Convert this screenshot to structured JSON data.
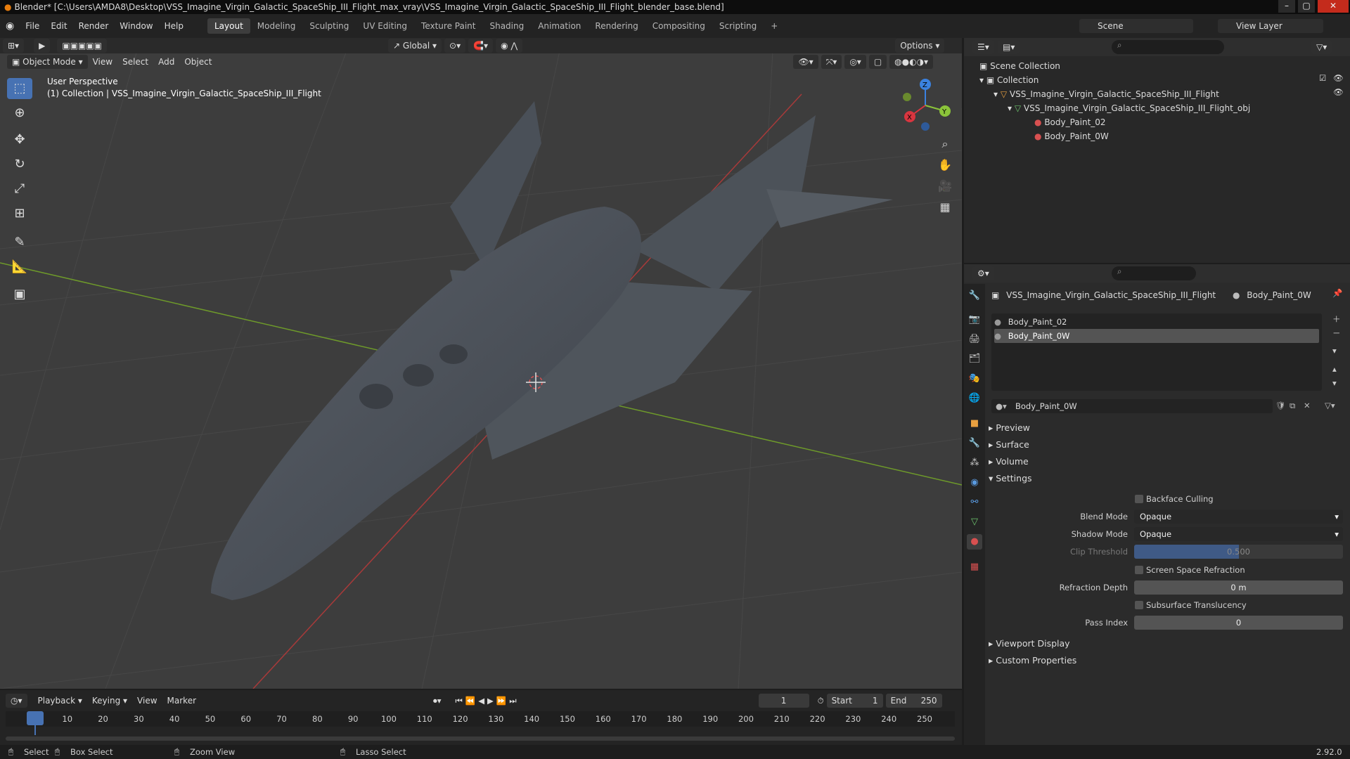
{
  "window": {
    "title": "Blender* [C:\\Users\\AMDA8\\Desktop\\VSS_Imagine_Virgin_Galactic_SpaceShip_III_Flight_max_vray\\VSS_Imagine_Virgin_Galactic_SpaceShip_III_Flight_blender_base.blend]",
    "minimize": "–",
    "maximize": "▢",
    "close": "✕"
  },
  "menu": [
    "File",
    "Edit",
    "Render",
    "Window",
    "Help"
  ],
  "workspaces": [
    "Layout",
    "Modeling",
    "Sculpting",
    "UV Editing",
    "Texture Paint",
    "Shading",
    "Animation",
    "Rendering",
    "Compositing",
    "Scripting"
  ],
  "active_workspace": "Layout",
  "add_workspace": "+",
  "scene": {
    "name": "Scene",
    "view_layer": "View Layer"
  },
  "viewport": {
    "orientation": "Global",
    "options": "Options",
    "mode": "Object Mode",
    "menus": [
      "View",
      "Select",
      "Add",
      "Object"
    ],
    "overlay_line1": "User Perspective",
    "overlay_line2": "(1) Collection | VSS_Imagine_Virgin_Galactic_SpaceShip_III_Flight",
    "gizmo": {
      "x": "X",
      "y": "Y",
      "z": "Z"
    }
  },
  "outliner": {
    "root": "Scene Collection",
    "collection": "Collection",
    "object": "VSS_Imagine_Virgin_Galactic_SpaceShip_III_Flight",
    "mesh": "VSS_Imagine_Virgin_Galactic_SpaceShip_III_Flight_obj",
    "materials": [
      "Body_Paint_02",
      "Body_Paint_0W"
    ]
  },
  "properties": {
    "breadcrumb_object": "VSS_Imagine_Virgin_Galactic_SpaceShip_III_Flight",
    "breadcrumb_material": "Body_Paint_0W",
    "slots": [
      "Body_Paint_02",
      "Body_Paint_0W"
    ],
    "selected_slot": "Body_Paint_0W",
    "material_name": "Body_Paint_0W",
    "panels": {
      "preview": "Preview",
      "surface": "Surface",
      "volume": "Volume",
      "settings": "Settings",
      "viewport_display": "Viewport Display",
      "custom_properties": "Custom Properties"
    },
    "settings": {
      "backface_culling": "Backface Culling",
      "blend_mode_label": "Blend Mode",
      "blend_mode": "Opaque",
      "shadow_mode_label": "Shadow Mode",
      "shadow_mode": "Opaque",
      "clip_threshold_label": "Clip Threshold",
      "clip_threshold": "0.500",
      "screen_space_refraction": "Screen Space Refraction",
      "refraction_depth_label": "Refraction Depth",
      "refraction_depth": "0 m",
      "subsurface_translucency": "Subsurface Translucency",
      "pass_index_label": "Pass Index",
      "pass_index": "0"
    }
  },
  "timeline": {
    "menus": [
      "Playback",
      "Keying",
      "View",
      "Marker"
    ],
    "current_frame": "1",
    "start_label": "Start",
    "start": "1",
    "end_label": "End",
    "end": "250",
    "ticks": [
      "1",
      "10",
      "20",
      "30",
      "40",
      "50",
      "60",
      "70",
      "80",
      "90",
      "100",
      "110",
      "120",
      "130",
      "140",
      "150",
      "160",
      "170",
      "180",
      "190",
      "200",
      "210",
      "220",
      "230",
      "240",
      "250"
    ]
  },
  "status": {
    "select": "Select",
    "box_select": "Box Select",
    "zoom_view": "Zoom View",
    "lasso_select": "Lasso Select",
    "version": "2.92.0"
  },
  "colors": {
    "accent": "#4772b3",
    "x_axis": "#d8353f",
    "y_axis": "#8bc43a",
    "z_axis": "#3b82e0"
  }
}
